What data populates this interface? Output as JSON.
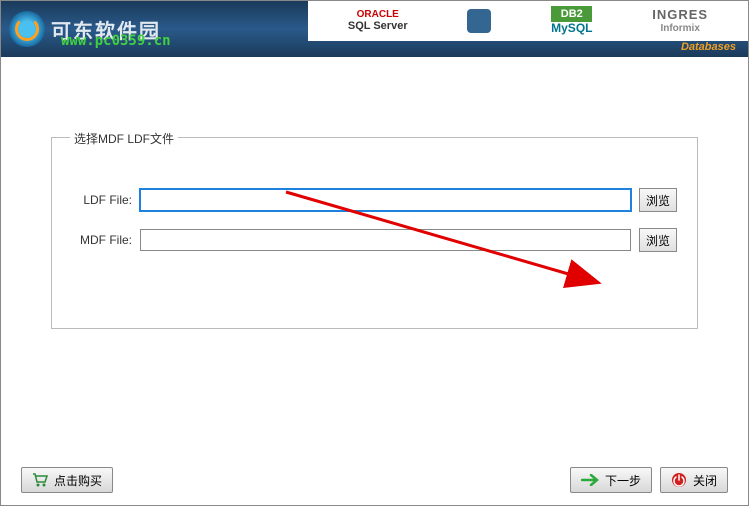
{
  "header": {
    "site_name": "可东软件园",
    "url": "www.pc0359.cn",
    "databases_label": "Databases",
    "db_logos": {
      "oracle": "ORACLE",
      "sqlserver": "SQL Server",
      "db2": "DB2",
      "mysql": "MySQL",
      "ingres": "INGRES",
      "informix": "Informix"
    }
  },
  "form": {
    "fieldset_title": "选择MDF LDF文件",
    "ldf_label": "LDF File:",
    "ldf_value": "",
    "mdf_label": "MDF File:",
    "mdf_value": "",
    "browse_button": "浏览"
  },
  "footer": {
    "buy_button": "点击购买",
    "next_button": "下一步",
    "close_button": "关闭"
  }
}
